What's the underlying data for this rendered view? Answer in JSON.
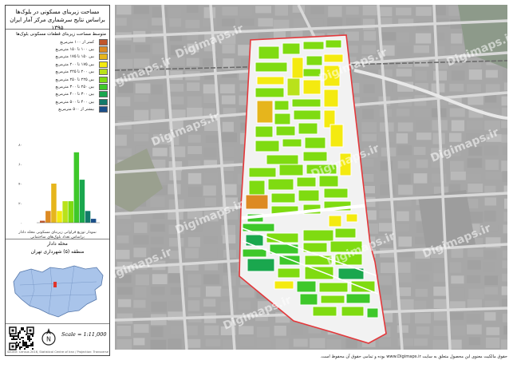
{
  "panel": {
    "title_line1": "مساحت زیربنای مسکونی در بلوک‌ها",
    "title_line2": "براساس نتایج سرشماری مرکز آمار ایران ۱۳۹۵"
  },
  "legend": {
    "header": "متوسط مساحت زیربنای قطعات مسکونی بلوک‌ها",
    "items": [
      {
        "label": "کمتر از ۱۰۰ مترمربع",
        "color": "#c0562b"
      },
      {
        "label": "بین ۱۰۰ تا ۱۵۰ مترمربع",
        "color": "#dd8a23"
      },
      {
        "label": "بین ۱۵۰ تا ۱۷۵ مترمربع",
        "color": "#e6b51c"
      },
      {
        "label": "بین ۱۷۵ تا ۲۰۰ مترمربع",
        "color": "#f4ea10"
      },
      {
        "label": "بین ۲۰۰ تا ۲۲۵ مترمربع",
        "color": "#b9e21a"
      },
      {
        "label": "بین ۲۲۵ تا ۲۵۰ مترمربع",
        "color": "#7fdb11"
      },
      {
        "label": "بین ۲۵۰ تا ۳۰۰ مترمربع",
        "color": "#3ec82a"
      },
      {
        "label": "بین ۳۰۰ تا ۴۰۰ مترمربع",
        "color": "#1aa74e"
      },
      {
        "label": "بین ۴۰۰ تا ۵۰۰ مترمربع",
        "color": "#137a6a"
      },
      {
        "label": "بیشتر از ۵۰۰ مترمربع",
        "color": "#1a4f8a"
      }
    ]
  },
  "histogram": {
    "values": [
      2,
      12,
      40,
      12,
      22,
      22,
      72,
      44,
      12,
      4
    ],
    "ymax": 80,
    "yticks": [
      "۸۰",
      "۶۰",
      "۴۰",
      "۲۰",
      "۰"
    ],
    "caption_line1": "نمودار توزیع فراوانی زیربنای مسکونی محله دادار",
    "caption_line2": "براساس تعداد بلوک‌های ساختمانی"
  },
  "location": {
    "neighborhood": "محله دادار",
    "district": "منطقه (۵) شهرداری تهران"
  },
  "scale_text": "Scale = 1:11,000",
  "north_label": "N",
  "credit_text": "Source: Census 2016, Statistical Centre of Iran / Projection: Transverse Mercator",
  "watermark": "Digimaps.ir",
  "footer_text": "حقوق مالکیت معنوی این محصول متعلق به سایت www.Digimaps.ir بوده و تمامی حقوق آن محفوظ است."
}
